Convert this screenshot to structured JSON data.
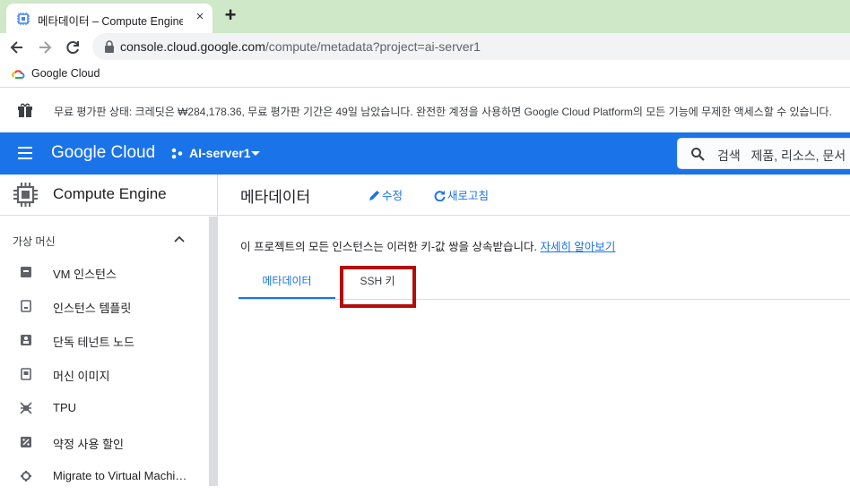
{
  "browser": {
    "tab_title": "메타데이터 – Compute Engine –",
    "tab_close": "×",
    "new_tab": "+",
    "url_host": "console.cloud.google.com",
    "url_path": "/compute/metadata?project=ai-server1",
    "bookmark": "Google Cloud"
  },
  "banner": {
    "text": "무료 평가판 상태: 크레딧은 ₩284,178.36, 무료 평가판 기간은 49일 남았습니다. 완전한 계정을 사용하면 Google Cloud Platform의 모든 기능에 무제한 액세스할 수 있습니다."
  },
  "header": {
    "brand": "Google Cloud",
    "project": "AI-server1",
    "search_label": "검색",
    "search_placeholder": "제품, 리소스, 문서"
  },
  "sidebar": {
    "product": "Compute Engine",
    "section": "가상 머신",
    "items": [
      {
        "label": "VM 인스턴스",
        "icon": "vm-instances-icon"
      },
      {
        "label": "인스턴스 템플릿",
        "icon": "instance-templates-icon"
      },
      {
        "label": "단독 테넌트 노드",
        "icon": "sole-tenant-icon"
      },
      {
        "label": "머신 이미지",
        "icon": "machine-image-icon"
      },
      {
        "label": "TPU",
        "icon": "tpu-icon"
      },
      {
        "label": "약정 사용 할인",
        "icon": "committed-use-icon"
      },
      {
        "label": "Migrate to Virtual Machin...",
        "icon": "migrate-icon"
      }
    ]
  },
  "main": {
    "title": "메타데이터",
    "edit": "수정",
    "refresh": "새로고침",
    "inherit_text": "이 프로젝트의 모든 인스턴스는 이러한 키-값 쌍을 상속받습니다.",
    "learn_more": "자세히 알아보기",
    "tabs": [
      {
        "label": "메타데이터",
        "active": true
      },
      {
        "label": "SSH 키",
        "active": false
      }
    ]
  },
  "colors": {
    "brand_blue": "#1a73e8",
    "highlight_red": "#b50c0c",
    "tabstrip_green": "#cfe8c7"
  }
}
